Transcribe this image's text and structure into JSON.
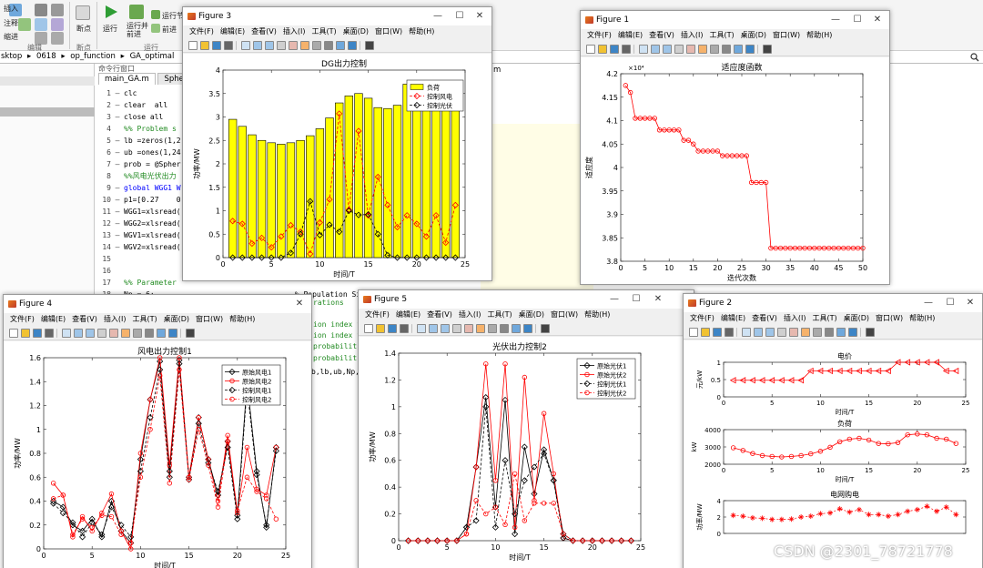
{
  "toolstrip": {
    "buttons": [
      "插入",
      "注释",
      "缩进",
      "断点",
      "运行",
      "运行并\n前进",
      "运行节",
      "前进"
    ],
    "sections": [
      "编辑",
      "断点",
      "运行"
    ]
  },
  "pathbar": {
    "items": [
      "sktop",
      "0618",
      "op_function",
      "GA_optimal"
    ],
    "separators": [
      "▸",
      "▸",
      "▸"
    ]
  },
  "left_panel": {
    "title": "命令行窗口"
  },
  "editor": {
    "tabs": [
      "main_GA.m",
      "Sphe"
    ],
    "tab_right": "m",
    "lines": [
      {
        "n": "1",
        "code": "clc",
        "mk": "—"
      },
      {
        "n": "2",
        "code": "clear  all",
        "mk": "—"
      },
      {
        "n": "3",
        "code": "close all",
        "mk": "—"
      },
      {
        "n": "4",
        "code": "%% Problem s",
        "mk": "",
        "cls": "cm"
      },
      {
        "n": "5",
        "code": "lb =zeros(1,2",
        "mk": "—"
      },
      {
        "n": "6",
        "code": "ub =ones(1,24",
        "mk": "—"
      },
      {
        "n": "7",
        "code": "prob = @Spher",
        "mk": "—"
      },
      {
        "n": "8",
        "code": "%%风电光伏出力",
        "mk": "",
        "cls": "cm"
      },
      {
        "n": "9",
        "code": "global WGG1 W",
        "mk": "—",
        "cls": "kw"
      },
      {
        "n": "10",
        "code": "p1=[0.27    0",
        "mk": "—"
      },
      {
        "n": "11",
        "code": "WGG1=xlsread(",
        "mk": "—"
      },
      {
        "n": "12",
        "code": "WGG2=xlsread(",
        "mk": "—"
      },
      {
        "n": "13",
        "code": "WGV1=xlsread(",
        "mk": "—"
      },
      {
        "n": "14",
        "code": "WGV2=xlsread(",
        "mk": "—"
      },
      {
        "n": "15",
        "code": "",
        "mk": ""
      },
      {
        "n": "16",
        "code": "",
        "mk": ""
      },
      {
        "n": "17",
        "code": "%% Parameter",
        "mk": "",
        "cls": "cm"
      },
      {
        "n": "18",
        "code": "Np = 6;                                % Population Size",
        "mk": "—"
      }
    ],
    "fragments": [
      "rations",
      "ion index f",
      "ion index f",
      "probabilit",
      "probabilit",
      "b,lb,ub,Np,"
    ]
  },
  "menus": {
    "full": [
      "文件(F)",
      "编辑(E)",
      "查看(V)",
      "插入(I)",
      "工具(T)",
      "桌面(D)",
      "窗口(W)",
      "帮助(H)"
    ]
  },
  "window_controls": [
    "—",
    "☐",
    "✕"
  ],
  "figures": {
    "f3": {
      "title": "Figure 3"
    },
    "f1": {
      "title": "Figure 1"
    },
    "f4": {
      "title": "Figure 4"
    },
    "f5": {
      "title": "Figure 5"
    },
    "f2": {
      "title": "Figure 2"
    }
  },
  "watermark": "CSDN @2301_78721778",
  "chart_data": [
    {
      "id": "fig3",
      "type": "bar",
      "title": "DG出力控制",
      "xlabel": "时间/T",
      "ylabel": "功率/MW",
      "xlim": [
        0,
        25
      ],
      "ylim": [
        0,
        4
      ],
      "xticks": [
        "0",
        "5",
        "10",
        "15",
        "20",
        "25"
      ],
      "yticks": [
        "0",
        "0.5",
        "1",
        "1.5",
        "2",
        "2.5",
        "3",
        "3.5",
        "4"
      ],
      "legend": [
        "负荷",
        "控制风电",
        "控制光伏"
      ],
      "legend_position": "top-right",
      "x": [
        1,
        2,
        3,
        4,
        5,
        6,
        7,
        8,
        9,
        10,
        11,
        12,
        13,
        14,
        15,
        16,
        17,
        18,
        19,
        20,
        21,
        22,
        23,
        24
      ],
      "series": [
        {
          "name": "负荷",
          "kind": "bar",
          "color": "#ffff00",
          "values": [
            2.95,
            2.8,
            2.62,
            2.5,
            2.45,
            2.42,
            2.45,
            2.5,
            2.6,
            2.75,
            2.98,
            3.3,
            3.45,
            3.5,
            3.4,
            3.2,
            3.18,
            3.25,
            3.7,
            3.75,
            3.7,
            3.5,
            3.45,
            3.2
          ]
        },
        {
          "name": "控制风电",
          "kind": "line",
          "color": "#ff0000",
          "marker": "diamond",
          "values": [
            0.78,
            0.72,
            0.3,
            0.42,
            0.22,
            0.45,
            0.69,
            0.55,
            0.08,
            0.75,
            1.24,
            3.07,
            1.02,
            2.7,
            0.9,
            1.72,
            1.12,
            0.65,
            0.9,
            0.72,
            0.45,
            0.9,
            0.32,
            1.12
          ]
        },
        {
          "name": "控制光伏",
          "kind": "line",
          "color": "#000000",
          "marker": "diamond",
          "values": [
            0,
            0,
            0,
            0,
            0,
            0,
            0.1,
            0.5,
            1.2,
            0.48,
            0.7,
            0.55,
            1.0,
            0.91,
            0.92,
            0.5,
            0.05,
            0,
            0,
            0,
            0,
            0,
            0,
            0
          ]
        }
      ]
    },
    {
      "id": "fig1",
      "type": "line",
      "title": "适应度函数",
      "xlabel": "迭代次数",
      "ylabel": "适应度",
      "exponent": "×10⁴",
      "xlim": [
        0,
        50
      ],
      "ylim": [
        3.8,
        4.2
      ],
      "xticks": [
        "0",
        "5",
        "10",
        "15",
        "20",
        "25",
        "30",
        "35",
        "40",
        "45",
        "50"
      ],
      "yticks": [
        "3.8",
        "3.85",
        "3.9",
        "3.95",
        "4",
        "4.05",
        "4.1",
        "4.15",
        "4.2"
      ],
      "series": [
        {
          "name": "",
          "color": "#ff0000",
          "marker": "circle",
          "x": [
            1,
            2,
            3,
            4,
            5,
            6,
            7,
            8,
            9,
            10,
            11,
            12,
            13,
            14,
            15,
            16,
            17,
            18,
            19,
            20,
            21,
            22,
            23,
            24,
            25,
            26,
            27,
            28,
            29,
            30,
            31,
            32,
            33,
            34,
            35,
            36,
            37,
            38,
            39,
            40,
            41,
            42,
            43,
            44,
            45,
            46,
            47,
            48,
            49,
            50
          ],
          "values": [
            4.175,
            4.16,
            4.105,
            4.105,
            4.105,
            4.105,
            4.105,
            4.08,
            4.08,
            4.08,
            4.08,
            4.08,
            4.058,
            4.058,
            4.05,
            4.035,
            4.035,
            4.035,
            4.035,
            4.035,
            4.025,
            4.025,
            4.025,
            4.025,
            4.025,
            4.025,
            3.968,
            3.968,
            3.968,
            3.968,
            3.828,
            3.828,
            3.828,
            3.828,
            3.828,
            3.828,
            3.828,
            3.828,
            3.828,
            3.828,
            3.828,
            3.828,
            3.828,
            3.828,
            3.828,
            3.828,
            3.828,
            3.828,
            3.828,
            3.828
          ]
        }
      ]
    },
    {
      "id": "fig4",
      "type": "line",
      "title": "风电出力控制1",
      "xlabel": "时间/T",
      "ylabel": "功率/MW",
      "xlim": [
        0,
        25
      ],
      "ylim": [
        0,
        1.6
      ],
      "xticks": [
        "0",
        "5",
        "10",
        "15",
        "20",
        "25"
      ],
      "yticks": [
        "0",
        "0.2",
        "0.4",
        "0.6",
        "0.8",
        "1",
        "1.2",
        "1.4",
        "1.6"
      ],
      "legend": [
        "原始风电1",
        "原始风电2",
        "控制风电1",
        "控制风电2"
      ],
      "legend_position": "top-right",
      "x": [
        1,
        2,
        3,
        4,
        5,
        6,
        7,
        8,
        9,
        10,
        11,
        12,
        13,
        14,
        15,
        16,
        17,
        18,
        19,
        20,
        21,
        22,
        23,
        24
      ],
      "series": [
        {
          "name": "原始风电1",
          "color": "#000000",
          "dash": "none",
          "values": [
            0.4,
            0.35,
            0.2,
            0.15,
            0.25,
            0.1,
            0.4,
            0.15,
            0.05,
            0.75,
            1.25,
            1.57,
            0.65,
            1.58,
            0.6,
            1.1,
            0.75,
            0.45,
            0.9,
            0.28,
            1.4,
            0.65,
            0.18,
            0.85
          ]
        },
        {
          "name": "原始风电2",
          "color": "#ff0000",
          "dash": "none",
          "values": [
            0.55,
            0.45,
            0.1,
            0.27,
            0.15,
            0.3,
            0.46,
            0.15,
            0.0,
            0.8,
            1.25,
            1.6,
            0.7,
            1.6,
            0.6,
            1.1,
            0.75,
            0.4,
            0.95,
            0.3,
            0.85,
            0.5,
            0.45,
            0.85
          ]
        },
        {
          "name": "控制风电1",
          "color": "#000000",
          "dash": "3,2",
          "values": [
            0.38,
            0.3,
            0.22,
            0.1,
            0.22,
            0.12,
            0.35,
            0.2,
            0.1,
            0.65,
            1.1,
            1.5,
            0.6,
            1.55,
            0.58,
            1.05,
            0.72,
            0.48,
            0.85,
            0.25,
            1.35,
            0.62,
            0.2,
            0.82
          ]
        },
        {
          "name": "控制风电2",
          "color": "#ff0000",
          "dash": "3,2",
          "values": [
            0.42,
            0.45,
            0.12,
            0.25,
            0.18,
            0.28,
            0.27,
            0.12,
            0.05,
            0.6,
            1.0,
            1.45,
            0.55,
            1.5,
            0.58,
            1.0,
            0.7,
            0.35,
            0.9,
            0.32,
            0.6,
            0.48,
            0.42,
            0.25
          ]
        }
      ]
    },
    {
      "id": "fig5",
      "type": "line",
      "title": "光伏出力控制2",
      "xlabel": "时间/T",
      "ylabel": "功率/MW",
      "xlim": [
        0,
        25
      ],
      "ylim": [
        0,
        1.4
      ],
      "xticks": [
        "0",
        "5",
        "10",
        "15",
        "20",
        "25"
      ],
      "yticks": [
        "0",
        "0.2",
        "0.4",
        "0.6",
        "0.8",
        "1",
        "1.2",
        "1.4"
      ],
      "legend": [
        "原始光伏1",
        "原始光伏2",
        "控制光伏1",
        "控制光伏2"
      ],
      "legend_position": "top-right",
      "x": [
        1,
        2,
        3,
        4,
        5,
        6,
        7,
        8,
        9,
        10,
        11,
        12,
        13,
        14,
        15,
        16,
        17,
        18,
        19,
        20,
        21,
        22,
        23,
        24
      ],
      "series": [
        {
          "name": "原始光伏1",
          "color": "#000000",
          "dash": "none",
          "values": [
            0,
            0,
            0,
            0,
            0,
            0,
            0.1,
            0.55,
            1.07,
            0.25,
            1.05,
            0.05,
            0.7,
            0.35,
            0.68,
            0.45,
            0.05,
            0,
            0,
            0,
            0,
            0,
            0,
            0
          ]
        },
        {
          "name": "原始光伏2",
          "color": "#ff0000",
          "dash": "none",
          "values": [
            0,
            0,
            0,
            0,
            0,
            0,
            0.05,
            0.55,
            1.32,
            0.45,
            1.32,
            0.1,
            1.22,
            0.3,
            0.95,
            0.5,
            0.02,
            0,
            0,
            0,
            0,
            0,
            0,
            0
          ]
        },
        {
          "name": "控制光伏1",
          "color": "#000000",
          "dash": "3,2",
          "values": [
            0,
            0,
            0,
            0,
            0,
            0,
            0.1,
            0.15,
            1.0,
            0.1,
            0.6,
            0.2,
            0.45,
            0.55,
            0.65,
            0.45,
            0.02,
            0,
            0,
            0,
            0,
            0,
            0,
            0
          ]
        },
        {
          "name": "控制光伏2",
          "color": "#ff0000",
          "dash": "3,2",
          "values": [
            0,
            0,
            0,
            0,
            0,
            0,
            0.05,
            0.3,
            0.2,
            0.25,
            0.12,
            0.5,
            0.15,
            0.28,
            0.28,
            0.28,
            0.05,
            0,
            0,
            0,
            0,
            0,
            0,
            0
          ]
        }
      ]
    },
    {
      "id": "fig2a",
      "type": "line",
      "title": "电价",
      "xlabel": "时间/T",
      "ylabel": "元/kW",
      "xlim": [
        0,
        25
      ],
      "ylim": [
        0,
        1
      ],
      "xticks": [
        "0",
        "5",
        "10",
        "15",
        "20",
        "25"
      ],
      "yticks": [
        "0",
        "0.5",
        "1"
      ],
      "x": [
        1,
        2,
        3,
        4,
        5,
        6,
        7,
        8,
        9,
        10,
        11,
        12,
        13,
        14,
        15,
        16,
        17,
        18,
        19,
        20,
        21,
        22,
        23,
        24
      ],
      "series": [
        {
          "name": "",
          "color": "#ff0000",
          "marker": "triangle-left",
          "values": [
            0.48,
            0.48,
            0.48,
            0.48,
            0.48,
            0.48,
            0.48,
            0.48,
            0.75,
            0.75,
            0.75,
            0.75,
            0.75,
            0.75,
            0.75,
            0.75,
            0.75,
            1,
            1,
            1,
            1,
            1,
            0.75,
            0.75
          ]
        }
      ]
    },
    {
      "id": "fig2b",
      "type": "line",
      "title": "负荷",
      "xlabel": "时间/T",
      "ylabel": "kW",
      "xlim": [
        0,
        25
      ],
      "ylim": [
        2000,
        4000
      ],
      "xticks": [
        "0",
        "5",
        "10",
        "15",
        "20",
        "25"
      ],
      "yticks": [
        "2000",
        "3000",
        "4000"
      ],
      "x": [
        1,
        2,
        3,
        4,
        5,
        6,
        7,
        8,
        9,
        10,
        11,
        12,
        13,
        14,
        15,
        16,
        17,
        18,
        19,
        20,
        21,
        22,
        23,
        24
      ],
      "series": [
        {
          "name": "",
          "color": "#ff0000",
          "marker": "circle",
          "values": [
            2950,
            2800,
            2620,
            2500,
            2450,
            2420,
            2450,
            2500,
            2600,
            2750,
            2980,
            3300,
            3450,
            3500,
            3400,
            3200,
            3180,
            3250,
            3700,
            3750,
            3700,
            3500,
            3450,
            3200
          ]
        }
      ]
    },
    {
      "id": "fig2c",
      "type": "line",
      "title": "电网购电",
      "xlabel": "",
      "ylabel": "功率/MW",
      "xlim": [
        0,
        25
      ],
      "ylim": [
        0,
        4
      ],
      "yticks": [
        "0",
        "2",
        "4"
      ],
      "x": [
        1,
        2,
        3,
        4,
        5,
        6,
        7,
        8,
        9,
        10,
        11,
        12,
        13,
        14,
        15,
        16,
        17,
        18,
        19,
        20,
        21,
        22,
        23,
        24
      ],
      "series": [
        {
          "name": "",
          "color": "#ff0000",
          "marker": "star",
          "values": [
            2.2,
            2.1,
            1.9,
            1.85,
            1.7,
            1.7,
            1.75,
            2.0,
            2.1,
            2.4,
            2.5,
            3.0,
            2.6,
            2.9,
            2.3,
            2.3,
            2.1,
            2.3,
            2.7,
            2.9,
            3.3,
            2.7,
            3.2,
            2.3
          ]
        }
      ]
    }
  ]
}
